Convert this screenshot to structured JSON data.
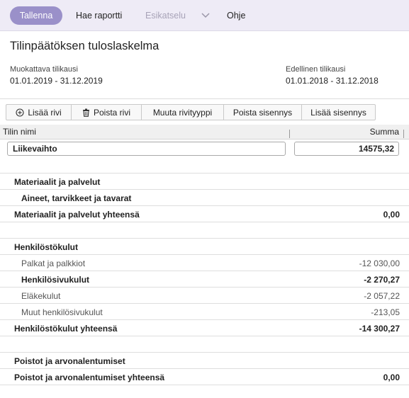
{
  "topbar": {
    "save_label": "Tallenna",
    "report_label": "Hae raportti",
    "preview_label": "Esikatselu",
    "help_label": "Ohje",
    "accent_color": "#9a90c9"
  },
  "page": {
    "title": "Tilinpäätöksen tuloslaskelma",
    "current_period_label": "Muokattava tilikausi",
    "current_period_value": "01.01.2019 - 31.12.2019",
    "previous_period_label": "Edellinen tilikausi",
    "previous_period_value": "01.01.2018 - 31.12.2018"
  },
  "toolbar": {
    "add_row": "Lisää rivi",
    "delete_row": "Poista rivi",
    "change_row_type": "Muuta rivityyppi",
    "remove_indent": "Poista sisennys",
    "add_indent": "Lisää sisennys"
  },
  "table": {
    "col_name": "Tilin nimi",
    "col_sum": "Summa",
    "edit_name": "Liikevaihto",
    "edit_sum": "14575,32",
    "rows": [
      {
        "label": "",
        "value": ""
      },
      {
        "label": "Materiaalit ja palvelut",
        "value": ""
      },
      {
        "label": "Aineet, tarvikkeet ja tavarat",
        "value": ""
      },
      {
        "label": "Materiaalit ja palvelut yhteensä",
        "value": "0,00"
      },
      {
        "label": "",
        "value": ""
      },
      {
        "label": "Henkilöstökulut",
        "value": ""
      },
      {
        "label": "Palkat ja palkkiot",
        "value": "-12 030,00"
      },
      {
        "label": "Henkilösivukulut",
        "value": "-2 270,27"
      },
      {
        "label": "Eläkekulut",
        "value": "-2 057,22"
      },
      {
        "label": "Muut henkilösivukulut",
        "value": "-213,05"
      },
      {
        "label": "Henkilöstökulut yhteensä",
        "value": "-14 300,27"
      },
      {
        "label": "",
        "value": ""
      },
      {
        "label": "Poistot ja arvonalentumiset",
        "value": ""
      },
      {
        "label": "Poistot ja arvonalentumiset yhteensä",
        "value": "0,00"
      }
    ]
  }
}
